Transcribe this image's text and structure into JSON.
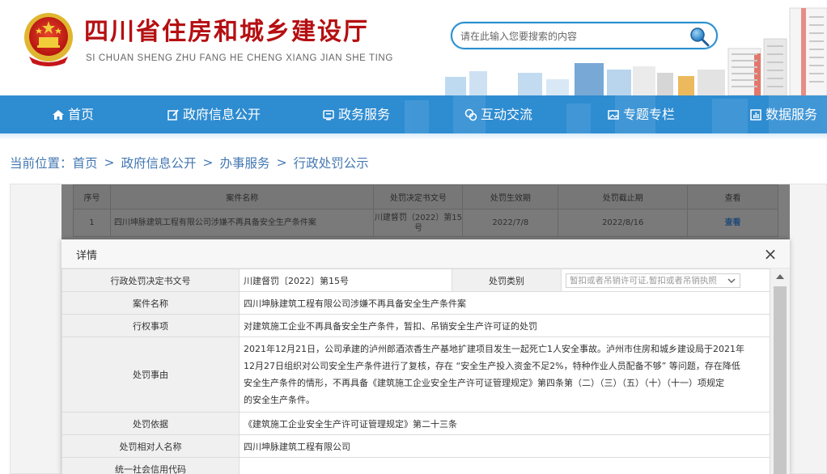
{
  "header": {
    "title": "四川省住房和城乡建设厅",
    "subtitle": "SI CHUAN SHENG ZHU FANG HE CHENG XIANG JIAN SHE TING",
    "search_placeholder": "请在此输入您要搜索的内容",
    "colors": {
      "title": "#b50f12",
      "search_border": "#2a8fd0"
    }
  },
  "nav": {
    "background": "#2e8cd1",
    "items": [
      {
        "label": "首页",
        "icon": "home-icon"
      },
      {
        "label": "政府信息公开",
        "icon": "edit-icon"
      },
      {
        "label": "政务服务",
        "icon": "monitor-icon"
      },
      {
        "label": "互动交流",
        "icon": "chat-icon"
      },
      {
        "label": "专题专栏",
        "icon": "image-icon"
      },
      {
        "label": "数据服务",
        "icon": "chart-icon"
      }
    ]
  },
  "breadcrumb": {
    "prefix": "当前位置：",
    "items": [
      "首页",
      "政府信息公开",
      "办事服务",
      "行政处罚公示"
    ],
    "separator": ">"
  },
  "list": {
    "headers": [
      "序号",
      "案件名称",
      "处罚决定书文号",
      "处罚生效期",
      "处罚截止期",
      "查看"
    ],
    "rows": [
      {
        "no": "1",
        "name": "四川坤脉建筑工程有限公司涉嫌不再具备安全生产条件案",
        "doc_no": "川建督罚（2022）第15号",
        "start": "2022/7/8",
        "end": "2022/8/16",
        "view": "查看"
      }
    ]
  },
  "modal": {
    "title": "详情",
    "close_icon": "close-icon",
    "fields": {
      "doc_no_label": "行政处罚决定书文号",
      "doc_no_value": "川建督罚〔2022〕第15号",
      "category_label": "处罚类别",
      "category_value": "暂扣或者吊销许可证,暂扣或者吊销执照",
      "case_name_label": "案件名称",
      "case_name_value": "四川坤脉建筑工程有限公司涉嫌不再具备安全生产条件案",
      "matter_label": "行权事项",
      "matter_value": "对建筑施工企业不再具备安全生产条件，暂扣、吊销安全生产许可证的处罚",
      "reason_label": "处罚事由",
      "reason_lines": [
        "2021年12月21日，公司承建的泸州郎酒浓香生产基地扩建项目发生一起死亡1人安全事故。泸州市住房和城乡建设局于2021年",
        "12月27日组织对公司安全生产条件进行了复核，存在 “安全生产投入资金不足2%，特种作业人员配备不够” 等问题，存在降低",
        "安全生产条件的情形，不再具备《建筑施工企业安全生产许可证管理规定》第四条第（二）（三）（五）（十）（十一）项规定",
        "的安全生产条件。"
      ],
      "basis_label": "处罚依据",
      "basis_value": "《建筑施工企业安全生产许可证管理规定》第二十三条",
      "party_label": "处罚相对人名称",
      "party_value": "四川坤脉建筑工程有限公司",
      "credit_code_label": "统一社会信用代码",
      "credit_code_value": ""
    }
  }
}
